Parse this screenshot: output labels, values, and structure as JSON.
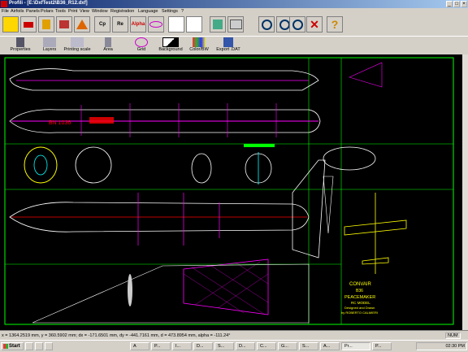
{
  "window": {
    "title": "Profili - [E:\\DxfTest2\\B36_R12.dxf]",
    "controls": [
      "_",
      "□",
      "×"
    ]
  },
  "menu": [
    "File",
    "Airfoils",
    "Panels",
    "Polars",
    "Tools",
    "Print",
    "View",
    "Window",
    "Registration",
    "Language",
    "Settings",
    "?"
  ],
  "toolbar_main": [
    {
      "icon": "open-folder-icon",
      "text": ""
    },
    {
      "icon": "airfoil-database-icon",
      "text": ""
    },
    {
      "icon": "airfoil-list-icon",
      "text": ""
    },
    {
      "icon": "airfoil-edit-icon",
      "text": ""
    },
    {
      "icon": "panels-icon",
      "text": ""
    },
    {
      "icon": "cp-icon",
      "text": "Cp"
    },
    {
      "icon": "re-icon",
      "text": "Re"
    },
    {
      "icon": "alpha-icon",
      "text": "Alpha"
    },
    {
      "icon": "airfoil-plot-icon",
      "text": ""
    },
    {
      "icon": "compare-icon",
      "text": ""
    },
    {
      "icon": "chart-icon",
      "text": ""
    },
    {
      "icon": "image-icon",
      "text": ""
    },
    {
      "icon": "print-icon",
      "text": ""
    },
    {
      "icon": "zoom-in-icon",
      "text": ""
    },
    {
      "icon": "zoom-out-icon",
      "text": ""
    },
    {
      "icon": "zoom-window-icon",
      "text": ""
    },
    {
      "icon": "close-drawing-icon",
      "text": ""
    },
    {
      "icon": "help-icon",
      "text": ""
    }
  ],
  "toolbar_drawing": [
    {
      "icon": "properties-icon",
      "label": "Properties"
    },
    {
      "icon": "layers-icon",
      "label": "Layers"
    },
    {
      "icon": "printing-scale-icon",
      "label": "Printing scale"
    },
    {
      "icon": "area-icon",
      "label": "Area"
    },
    {
      "icon": "grid-icon",
      "label": "Grid"
    },
    {
      "icon": "background-icon",
      "label": "Background"
    },
    {
      "icon": "color-bw-icon",
      "label": "Color/BW"
    },
    {
      "icon": "export-dat-icon",
      "label": "Export .DAT"
    }
  ],
  "drawing": {
    "labels": {
      "title1": "CONVAIR",
      "title2": "B36",
      "title3": "PEACEMAKER",
      "title4": "RC MODEL",
      "title5": "Designed and Drawn",
      "title6": "by ROBERTO CALMIERI",
      "side_text": "BN 1036"
    },
    "colors": {
      "background": "#000000",
      "frame": "#00ff00",
      "fuselage": "#ffffff",
      "highlight": "#ff00ff",
      "ribs": "#00ffff",
      "wing": "#ffff00",
      "marks": "#ff0000"
    }
  },
  "status": {
    "coords": "x = 1364.2519 mm, y = 360.5902 mm; dx = -171.6501 mm, dy = -441.7161 mm, d = 473.8954 mm, alpha = -111.24°",
    "num": "NUM"
  },
  "taskbar": {
    "start": "Start",
    "tasks": [
      "A",
      "P...",
      "I...",
      "D...",
      "S...",
      "D...",
      "C...",
      "G...",
      "S...",
      "A...",
      "Pr...",
      "P..."
    ],
    "clock": "02:30 PM"
  }
}
